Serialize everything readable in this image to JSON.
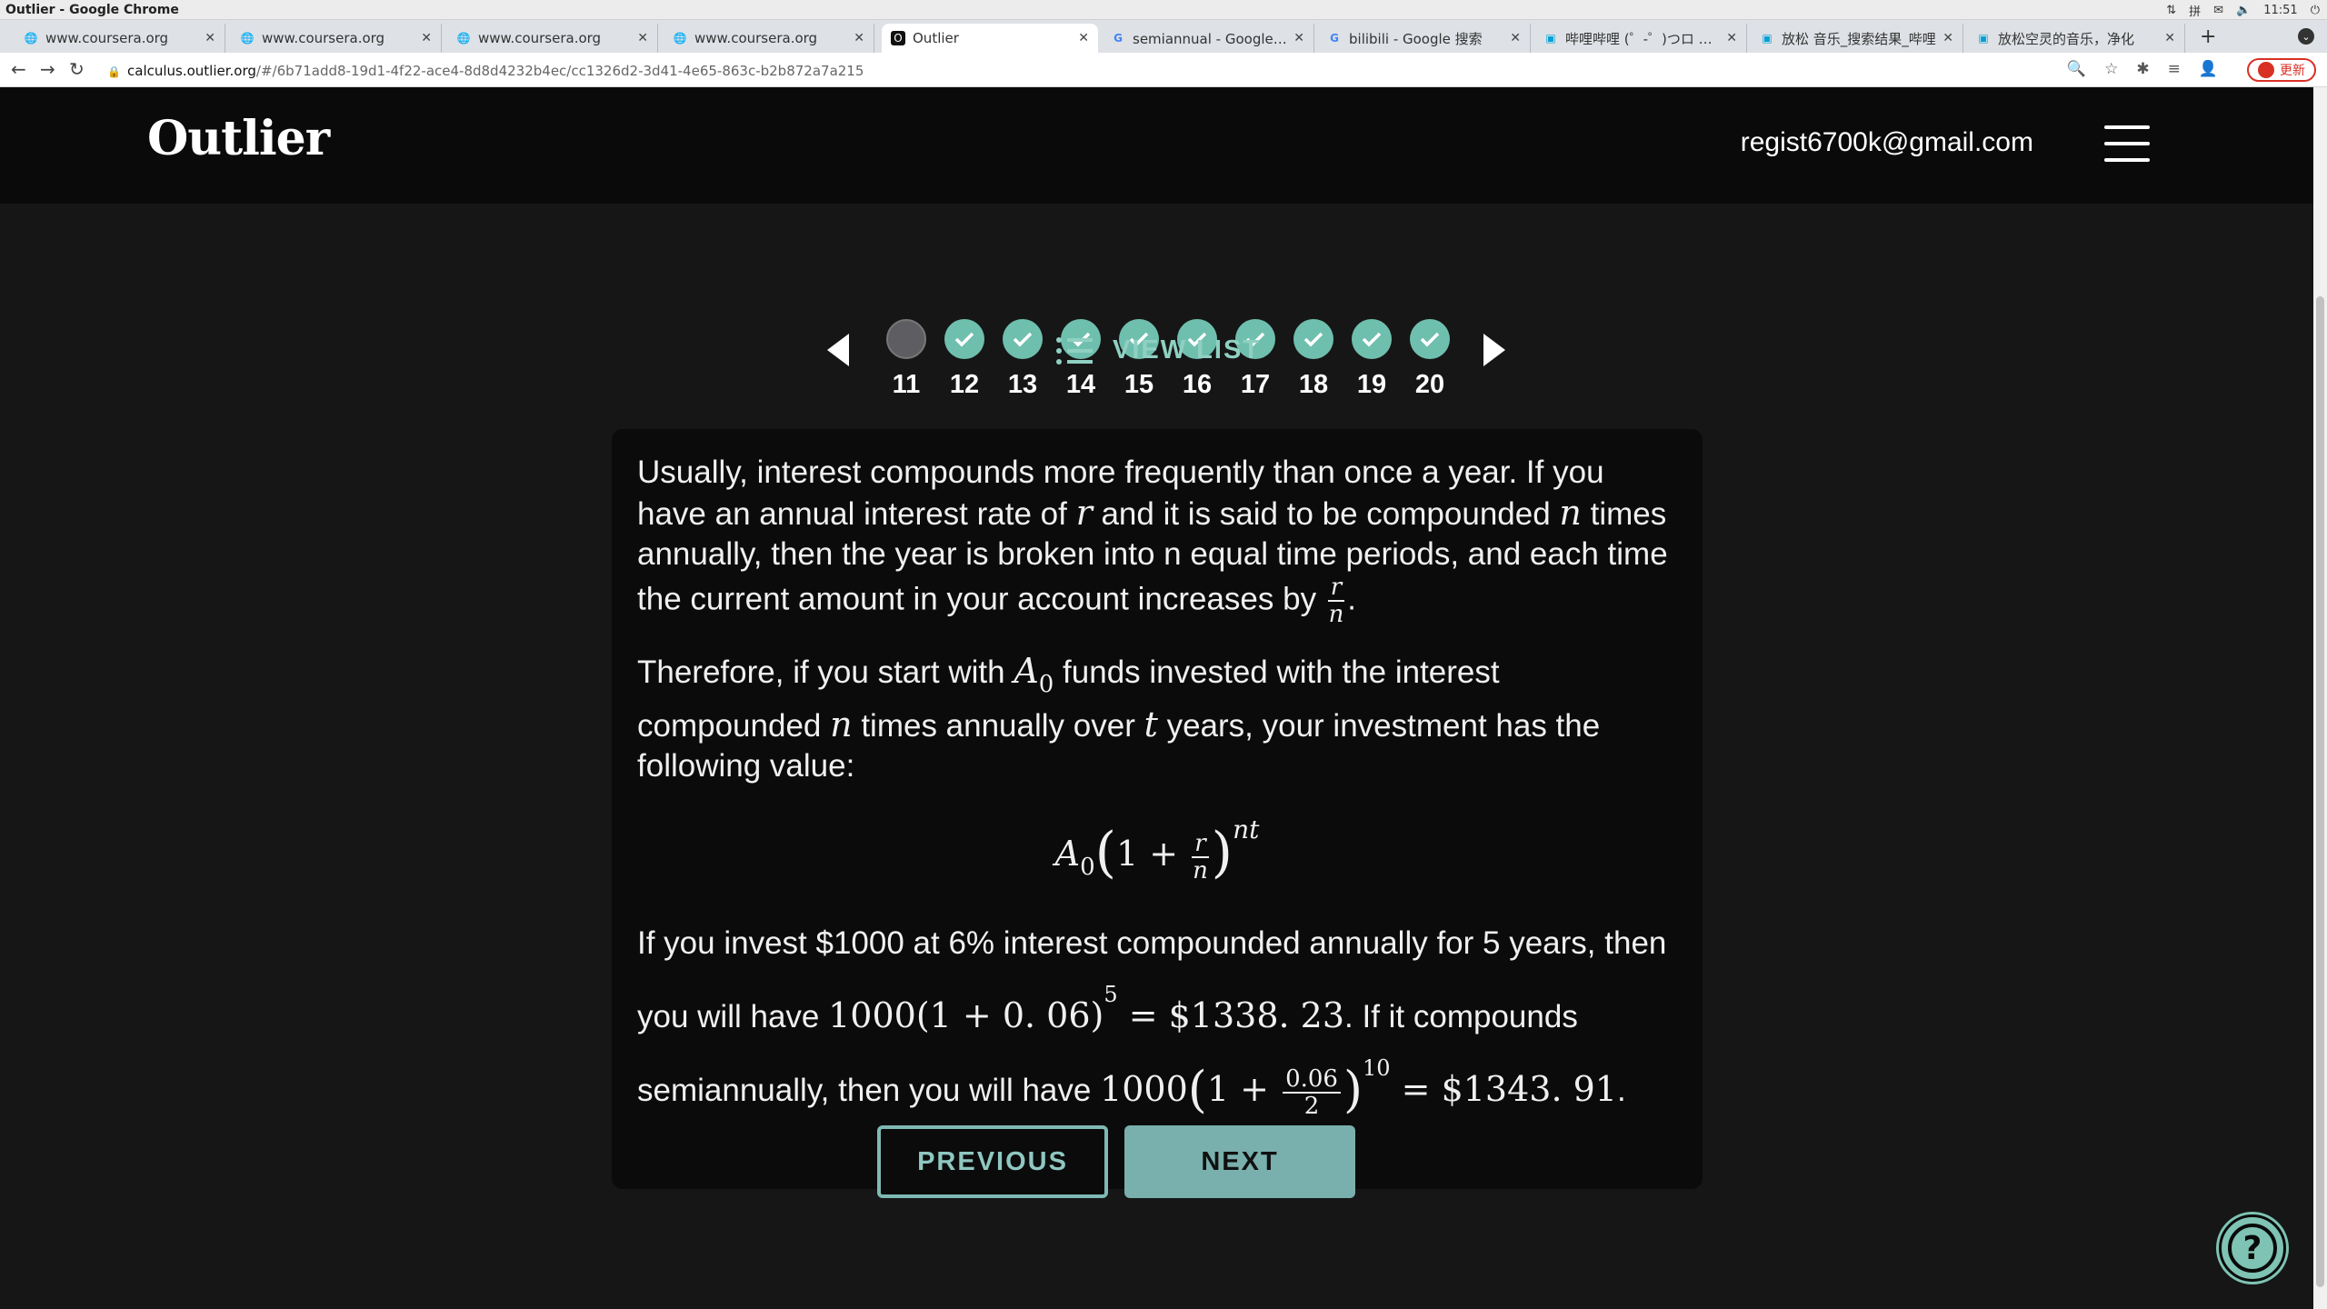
{
  "window": {
    "title": "Outlier - Google Chrome",
    "clock": "11:51"
  },
  "tabs": [
    {
      "label": "www.coursera.org",
      "icon": "globe-icon"
    },
    {
      "label": "www.coursera.org",
      "icon": "globe-icon"
    },
    {
      "label": "www.coursera.org",
      "icon": "globe-icon"
    },
    {
      "label": "www.coursera.org",
      "icon": "globe-icon"
    },
    {
      "label": "Outlier",
      "icon": "outlier-icon",
      "active": true
    },
    {
      "label": "semiannual - Google 搜索",
      "icon": "google-icon"
    },
    {
      "label": "bilibili - Google 搜索",
      "icon": "google-icon"
    },
    {
      "label": "哔哩哔哩 (゜-゜)つロ 干杯",
      "icon": "bilibili-icon"
    },
    {
      "label": "放松 音乐_搜索结果_哔哩",
      "icon": "bilibili-icon"
    },
    {
      "label": "放松空灵的音乐，净化",
      "icon": "bilibili-icon"
    }
  ],
  "address_bar": {
    "host": "calculus.outlier.org",
    "path": "/#/6b71add8-19d1-4f22-ace4-8d8d4232b4ec/cc1326d2-3d41-4e65-863c-b2b872a7a215"
  },
  "update_button": "更新",
  "header": {
    "logo": "Outlier",
    "email": "regist6700k@gmail.com"
  },
  "pager": {
    "questions": [
      {
        "number": "11",
        "status": "current"
      },
      {
        "number": "12",
        "status": "done"
      },
      {
        "number": "13",
        "status": "done"
      },
      {
        "number": "14",
        "status": "done"
      },
      {
        "number": "15",
        "status": "done"
      },
      {
        "number": "16",
        "status": "done"
      },
      {
        "number": "17",
        "status": "done"
      },
      {
        "number": "18",
        "status": "done"
      },
      {
        "number": "19",
        "status": "done"
      },
      {
        "number": "20",
        "status": "done"
      }
    ],
    "view_list": "VIEW LIST"
  },
  "content": {
    "p1": {
      "a": "Usually, interest compounds more frequently than once a year. If you have an annual interest rate of ",
      "r": "r",
      "b": " and it is said to be compounded ",
      "n": "n",
      "c": " times annually, then the year is broken into n equal time periods, and each time the current amount in your account increases by ",
      "frac_num": "r",
      "frac_den": "n",
      "d": "."
    },
    "p2": {
      "a": "Therefore, if you start with ",
      "A": "A",
      "A_sub": "0",
      "b": " funds invested with the interest compounded ",
      "n": "n",
      "c": " times annually over ",
      "t": "t",
      "d": " years, your investment has the following value:"
    },
    "formula": {
      "A": "A",
      "A_sub": "0",
      "one_plus": "1 + ",
      "frac_num": "r",
      "frac_den": "n",
      "exponent": "nt"
    },
    "p3": {
      "a": "If you invest $1000 at 6% interest compounded annually for 5 years, then you will have ",
      "m1": "1000(1 + 0. 06)",
      "m1_exp": "5",
      "m1_result": " = $1338. 23",
      "b": ". If it compounds semiannually, then you will have ",
      "m2_pre": "1000",
      "m2_one_plus": "1 + ",
      "m2_frac_num": "0.06",
      "m2_frac_den": "2",
      "m2_exp": "10",
      "m2_result": " = $1343. 91",
      "c": "."
    }
  },
  "buttons": {
    "previous": "PREVIOUS",
    "next": "NEXT"
  },
  "colors": {
    "accent": "#6fbfae",
    "background": "#161616",
    "header": "#0a0a0a"
  }
}
